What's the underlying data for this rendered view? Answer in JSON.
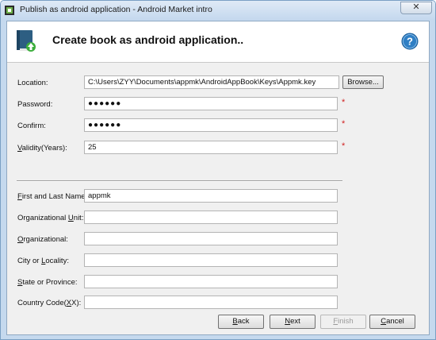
{
  "window": {
    "title": "Publish as android application - Android Market intro",
    "close_label": "✕"
  },
  "header": {
    "title": "Create book as android application..",
    "help_label": "?"
  },
  "form": {
    "location": {
      "label_pre": "",
      "label_u": "",
      "label_post": "Location:",
      "value": "C:\\Users\\ZYY\\Documents\\appmk\\AndroidAppBook\\Keys\\Appmk.key"
    },
    "password": {
      "label_pre": "",
      "label_u": "",
      "label_post": "Password:",
      "value": "●●●●●●"
    },
    "confirm": {
      "label_pre": "",
      "label_u": "",
      "label_post": "Confirm:",
      "value": "●●●●●●"
    },
    "validity": {
      "label_pre": "",
      "label_u": "V",
      "label_post": "alidity(Years):",
      "value": "25"
    },
    "first_last_name": {
      "label_pre": "",
      "label_u": "F",
      "label_post": "irst and Last Name:",
      "value": "appmk"
    },
    "org_unit": {
      "label_pre": "Organizational ",
      "label_u": "U",
      "label_post": "nit:",
      "value": ""
    },
    "organizational": {
      "label_pre": "",
      "label_u": "O",
      "label_post": "rganizational:",
      "value": ""
    },
    "city": {
      "label_pre": "City or ",
      "label_u": "L",
      "label_post": "ocality:",
      "value": ""
    },
    "state": {
      "label_pre": "",
      "label_u": "S",
      "label_post": "tate or Province:",
      "value": ""
    },
    "country": {
      "label_pre": "Country Code(",
      "label_u": "X",
      "label_post": "X):",
      "value": ""
    },
    "required_mark": "*",
    "browse_label": "Browse..."
  },
  "buttons": {
    "back": {
      "u": "B",
      "rest": "ack"
    },
    "next": {
      "u": "N",
      "rest": "ext"
    },
    "finish": {
      "u": "F",
      "rest": "inish"
    },
    "cancel": {
      "u": "C",
      "rest": "ancel"
    }
  },
  "colors": {
    "accent": "#2f7fc4",
    "required": "#d02020"
  }
}
